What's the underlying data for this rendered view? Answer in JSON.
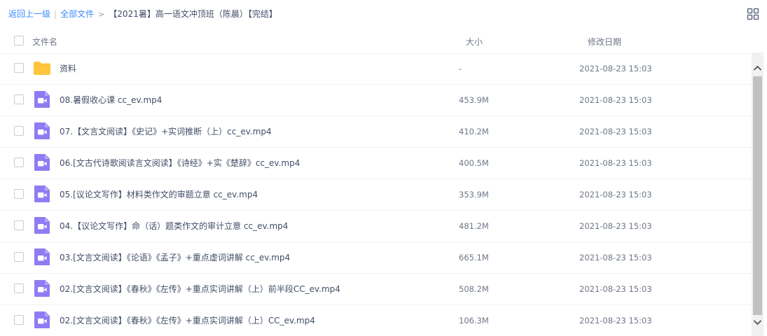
{
  "breadcrumb": {
    "back": "返回上一级",
    "separator": "|",
    "root": "全部文件",
    "arrow": ">",
    "current": "【2021暑】高一语文冲顶班（陈晨）【完结】"
  },
  "view_toggle_icon": "grid-view-icon",
  "header": {
    "name": "文件名",
    "size": "大小",
    "modified": "修改日期"
  },
  "colors": {
    "link": "#3b8cff",
    "folder": "#ffc53d",
    "video": "#8f7cf3"
  },
  "files": [
    {
      "name": "资料",
      "size": "-",
      "date": "2021-08-23 15:03",
      "type": "folder-icon"
    },
    {
      "name": "08.暑假收心课 cc_ev.mp4",
      "size": "453.9M",
      "date": "2021-08-23 15:03",
      "type": "video-icon"
    },
    {
      "name": "07.【文言文阅读】《史记》+实词推断（上）cc_ev.mp4",
      "size": "410.2M",
      "date": "2021-08-23 15:03",
      "type": "video-icon"
    },
    {
      "name": "06.[文古代诗歌阅读言文阅读】《诗经》+实《楚辞》cc_ev.mp4",
      "size": "400.5M",
      "date": "2021-08-23 15:03",
      "type": "video-icon"
    },
    {
      "name": "05.[议论文写作】材料类作文的审题立意 cc_ev.mp4",
      "size": "353.9M",
      "date": "2021-08-23 15:03",
      "type": "video-icon"
    },
    {
      "name": "04.【议论文写作】命（话）题类作文的审计立意 cc_ev.mp4",
      "size": "481.2M",
      "date": "2021-08-23 15:03",
      "type": "video-icon"
    },
    {
      "name": "03.[文言文阅读】《论语》《孟子》+重点虚词讲解 cc_ev.mp4",
      "size": "665.1M",
      "date": "2021-08-23 15:03",
      "type": "video-icon"
    },
    {
      "name": "02.[文言文阅读】《春秋》《左传》+重点实词讲解（上）前半段CC_ev.mp4",
      "size": "508.2M",
      "date": "2021-08-23 15:03",
      "type": "video-icon"
    },
    {
      "name": "02.[文言文阅读】《春秋》《左传》+重点实词讲解（上）CC_ev.mp4",
      "size": "106.3M",
      "date": "2021-08-23 15:03",
      "type": "video-icon"
    }
  ]
}
